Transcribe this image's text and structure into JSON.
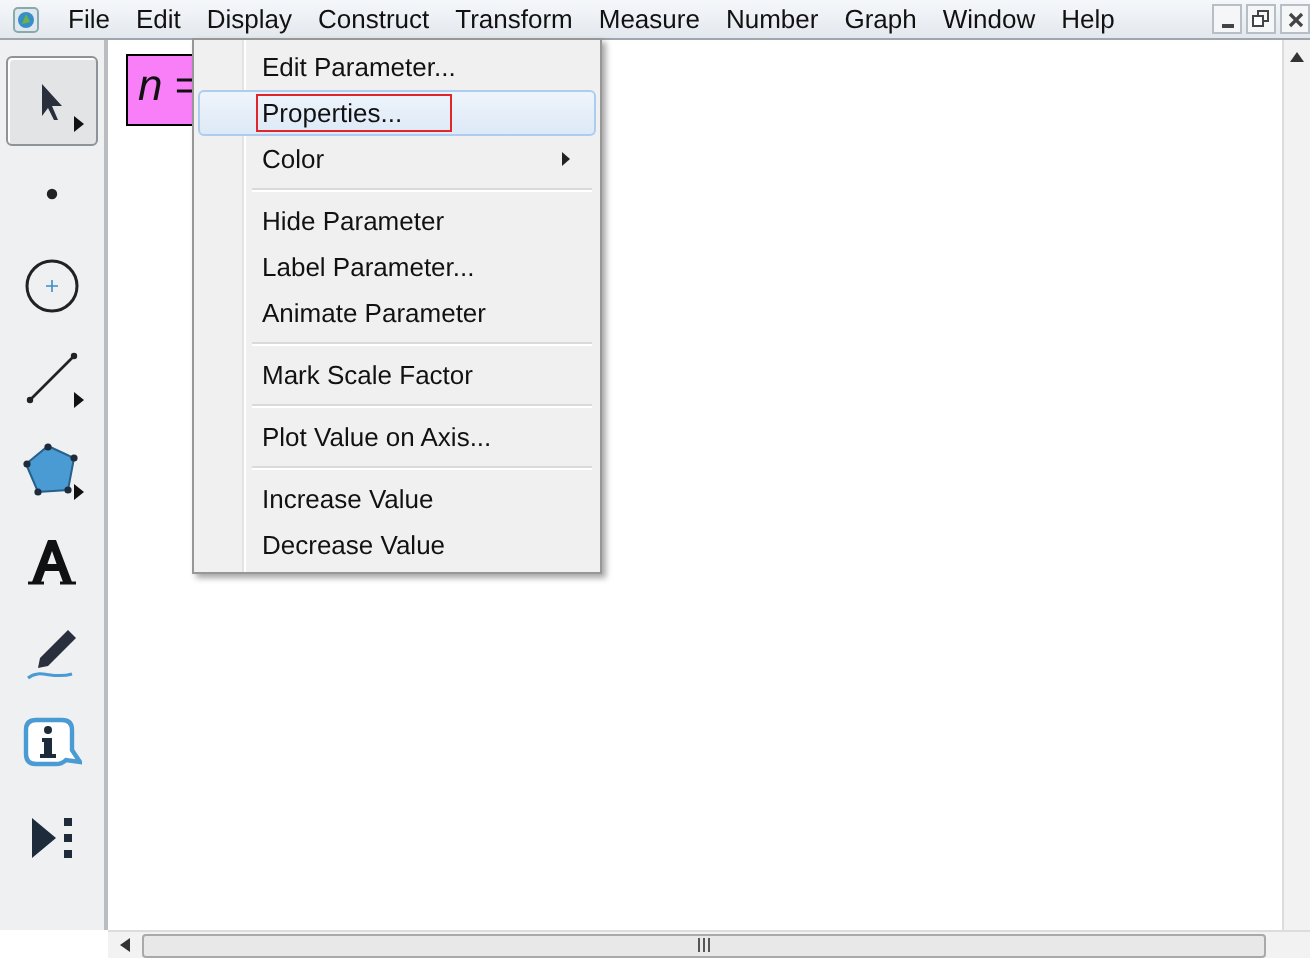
{
  "menu_bar": [
    {
      "label": "File"
    },
    {
      "label": "Edit"
    },
    {
      "label": "Display"
    },
    {
      "label": "Construct"
    },
    {
      "label": "Transform"
    },
    {
      "label": "Measure"
    },
    {
      "label": "Number"
    },
    {
      "label": "Graph"
    },
    {
      "label": "Window"
    },
    {
      "label": "Help"
    }
  ],
  "tools": [
    {
      "kind": "arrow",
      "selected": true,
      "flyout": true
    },
    {
      "kind": "point",
      "selected": false,
      "flyout": false
    },
    {
      "kind": "compass",
      "selected": false,
      "flyout": false
    },
    {
      "kind": "line",
      "selected": false,
      "flyout": true
    },
    {
      "kind": "polygon",
      "selected": false,
      "flyout": true
    },
    {
      "kind": "text",
      "selected": false,
      "flyout": false
    },
    {
      "kind": "marker",
      "selected": false,
      "flyout": false
    },
    {
      "kind": "info",
      "selected": false,
      "flyout": false
    },
    {
      "kind": "custom",
      "selected": false,
      "flyout": false
    }
  ],
  "parameter": {
    "label": "*n* ="
  },
  "context_menu": [
    {
      "kind": "item",
      "label": "Edit Parameter...",
      "selected": false,
      "submenu": false,
      "outlined": false
    },
    {
      "kind": "item",
      "label": "Properties...",
      "selected": true,
      "submenu": false,
      "outlined": true
    },
    {
      "kind": "item",
      "label": "Color",
      "selected": false,
      "submenu": true,
      "outlined": false
    },
    {
      "kind": "separator"
    },
    {
      "kind": "item",
      "label": "Hide Parameter",
      "selected": false,
      "submenu": false,
      "outlined": false
    },
    {
      "kind": "item",
      "label": "Label Parameter...",
      "selected": false,
      "submenu": false,
      "outlined": false
    },
    {
      "kind": "item",
      "label": "Animate Parameter",
      "selected": false,
      "submenu": false,
      "outlined": false
    },
    {
      "kind": "separator"
    },
    {
      "kind": "item",
      "label": "Mark Scale Factor",
      "selected": false,
      "submenu": false,
      "outlined": false
    },
    {
      "kind": "separator"
    },
    {
      "kind": "item",
      "label": "Plot Value on Axis...",
      "selected": false,
      "submenu": false,
      "outlined": false
    },
    {
      "kind": "separator"
    },
    {
      "kind": "item",
      "label": "Increase Value",
      "selected": false,
      "submenu": false,
      "outlined": false
    },
    {
      "kind": "item",
      "label": "Decrease Value",
      "selected": false,
      "submenu": false,
      "outlined": false
    }
  ]
}
